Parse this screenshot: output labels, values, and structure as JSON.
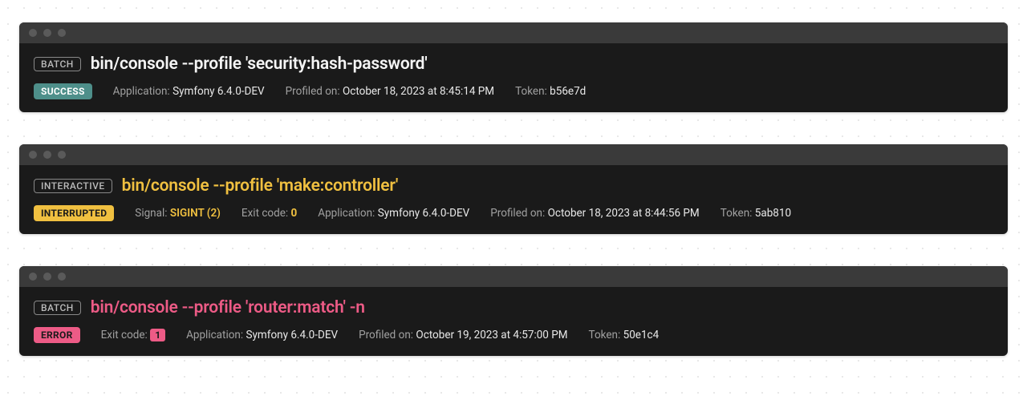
{
  "panels": [
    {
      "mode": "BATCH",
      "command": "bin/console --profile 'security:hash-password'",
      "cmdColor": "white",
      "status": {
        "label": "SUCCESS",
        "class": "status-success"
      },
      "meta": {
        "app_label": "Application:",
        "app_value": "Symfony 6.4.0-DEV",
        "profiled_label": "Profiled on:",
        "profiled_value": "October 18, 2023 at 8:45:14 PM",
        "token_label": "Token:",
        "token_value": "b56e7d"
      }
    },
    {
      "mode": "INTERACTIVE",
      "command": "bin/console --profile 'make:controller'",
      "cmdColor": "yellow",
      "status": {
        "label": "INTERRUPTED",
        "class": "status-interrupted"
      },
      "signal": {
        "label": "Signal:",
        "value": "SIGINT (2)"
      },
      "exit": {
        "label": "Exit code:",
        "value": "0",
        "style": "yellow"
      },
      "meta": {
        "app_label": "Application:",
        "app_value": "Symfony 6.4.0-DEV",
        "profiled_label": "Profiled on:",
        "profiled_value": "October 18, 2023 at 8:44:56 PM",
        "token_label": "Token:",
        "token_value": "5ab810"
      }
    },
    {
      "mode": "BATCH",
      "command": "bin/console --profile 'router:match' -n",
      "cmdColor": "pink",
      "status": {
        "label": "ERROR",
        "class": "status-error"
      },
      "exit": {
        "label": "Exit code:",
        "value": "1",
        "style": "pink"
      },
      "meta": {
        "app_label": "Application:",
        "app_value": "Symfony 6.4.0-DEV",
        "profiled_label": "Profiled on:",
        "profiled_value": "October 19, 2023 at 4:57:00 PM",
        "token_label": "Token:",
        "token_value": "50e1c4"
      }
    }
  ]
}
